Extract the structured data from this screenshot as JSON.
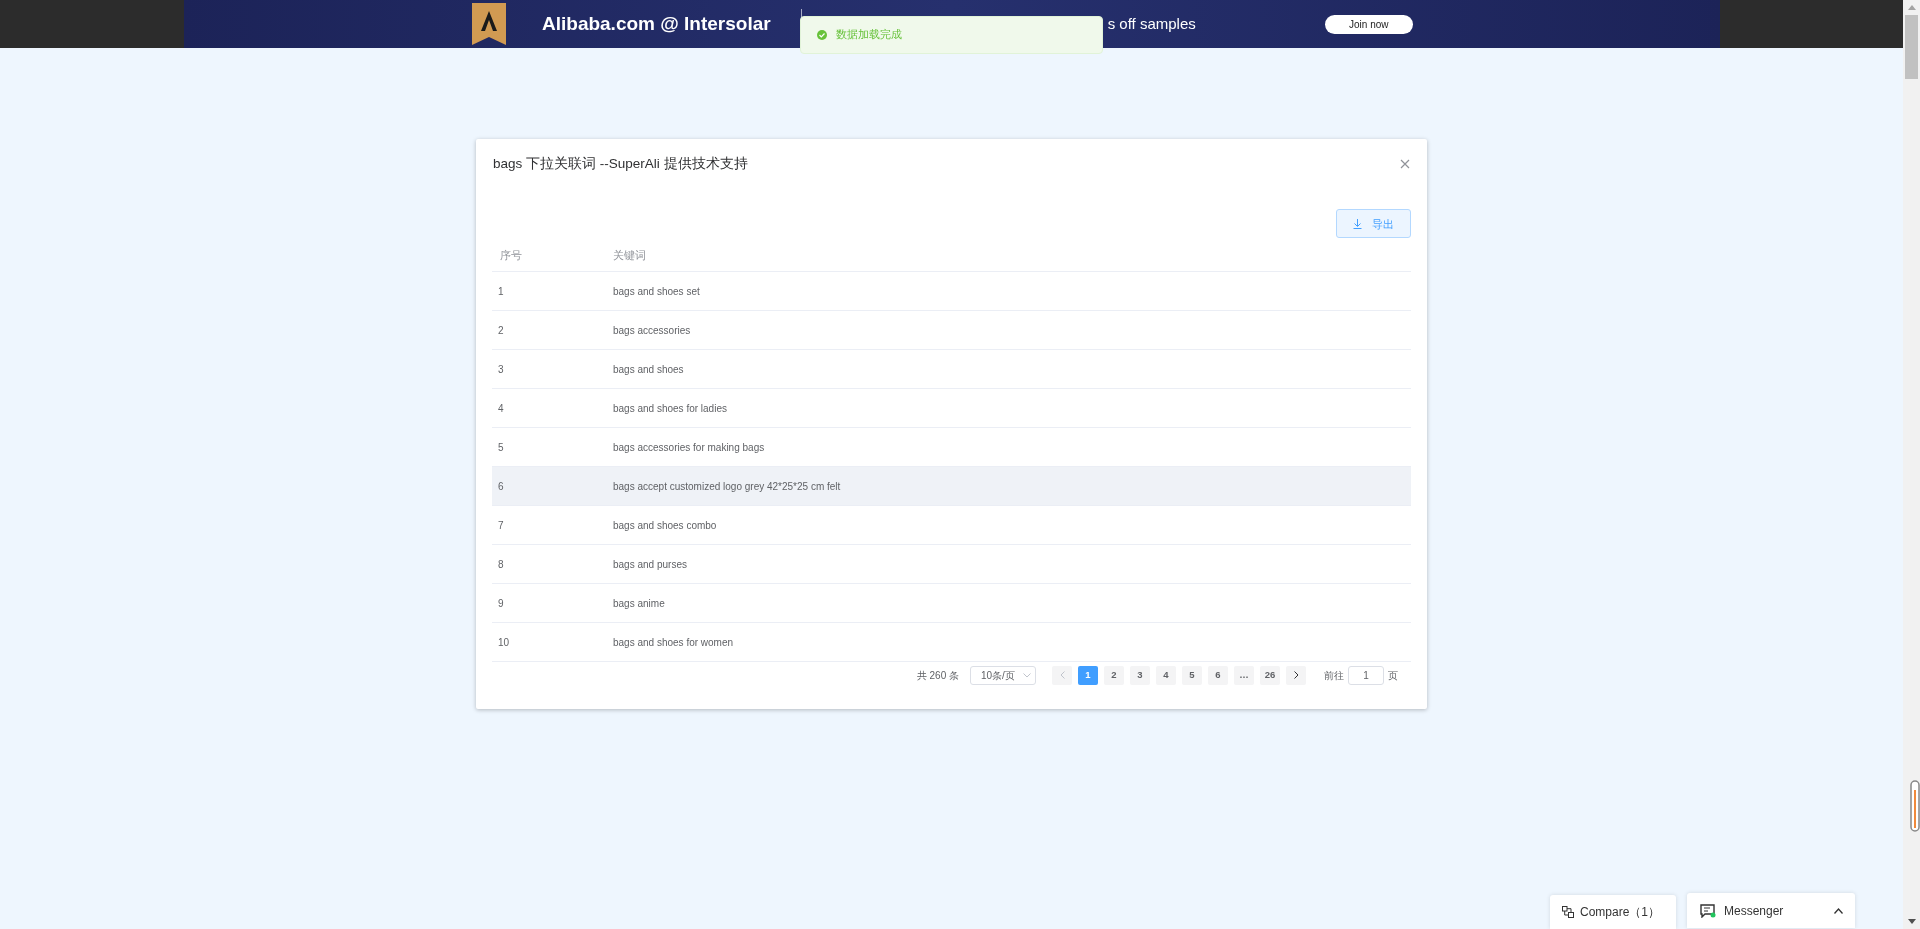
{
  "banner": {
    "brand": "Alibaba.com @ Intersolar",
    "tagline": "s off samples",
    "cta": "Join now"
  },
  "toast": {
    "message": "数据加载完成"
  },
  "dialog": {
    "title": "bags 下拉关联词 --SuperAli 提供技术支持",
    "export_button": "导出",
    "table": {
      "columns": [
        "序号",
        "关键词"
      ],
      "rows": [
        {
          "cells": [
            "1",
            "bags and shoes set"
          ],
          "highlighted": false
        },
        {
          "cells": [
            "2",
            "bags accessories"
          ],
          "highlighted": false
        },
        {
          "cells": [
            "3",
            "bags and shoes"
          ],
          "highlighted": false
        },
        {
          "cells": [
            "4",
            "bags and shoes for ladies"
          ],
          "highlighted": false
        },
        {
          "cells": [
            "5",
            "bags accessories for making bags"
          ],
          "highlighted": false
        },
        {
          "cells": [
            "6",
            "bags accept customized logo grey 42*25*25 cm felt"
          ],
          "highlighted": true
        },
        {
          "cells": [
            "7",
            "bags and shoes combo"
          ],
          "highlighted": false
        },
        {
          "cells": [
            "8",
            "bags and purses"
          ],
          "highlighted": false
        },
        {
          "cells": [
            "9",
            "bags anime"
          ],
          "highlighted": false
        },
        {
          "cells": [
            "10",
            "bags and shoes for women"
          ],
          "highlighted": false
        }
      ]
    },
    "pagination": {
      "total": "共 260 条",
      "page_size": "10条/页",
      "prev_disabled": true,
      "pages": [
        {
          "label": "1",
          "selected": true
        },
        {
          "label": "2",
          "selected": false
        },
        {
          "label": "3",
          "selected": false
        },
        {
          "label": "4",
          "selected": false
        },
        {
          "label": "5",
          "selected": false
        },
        {
          "label": "6",
          "selected": false
        },
        {
          "label": "…",
          "selected": false
        },
        {
          "label": "26",
          "selected": false
        }
      ],
      "goto_label": "前往",
      "goto_value": "1",
      "goto_suffix": "页"
    }
  },
  "floating_bar": {
    "compare": "Compare（1）",
    "messenger": "Messenger"
  }
}
